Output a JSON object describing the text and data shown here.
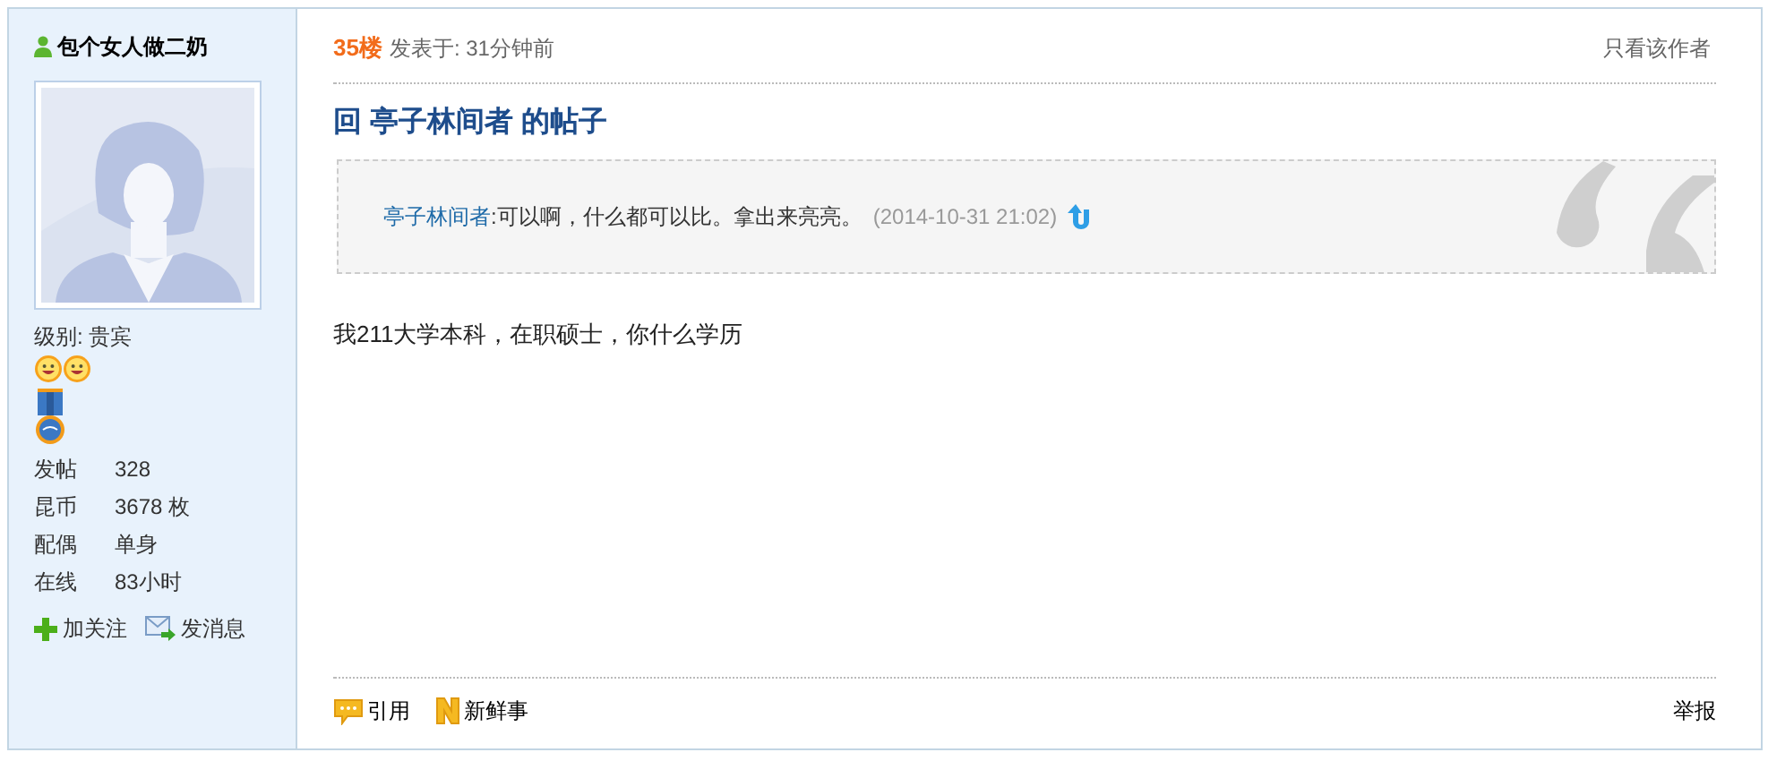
{
  "author": {
    "name": "包个女人做二奶",
    "level_label": "级别:",
    "level_value": "贵宾",
    "stats": [
      {
        "label": "发帖",
        "value": "328"
      },
      {
        "label": "昆币",
        "value": "3678 枚"
      },
      {
        "label": "配偶",
        "value": "单身"
      },
      {
        "label": "在线",
        "value": "83小时"
      }
    ],
    "actions": [
      {
        "kind": "follow",
        "label": "加关注"
      },
      {
        "kind": "message",
        "label": "发消息"
      }
    ]
  },
  "post": {
    "floor": "35楼",
    "posted": "发表于: 31分钟前",
    "author_only": "只看该作者",
    "title": "回 亭子林间者 的帖子",
    "quote": {
      "user": "亭子林间者",
      "text": ":可以啊，什么都可以比。拿出来亮亮。",
      "time": "(2014-10-31 21:02)"
    },
    "body": "我211大学本科，在职硕士，你什么学历",
    "footer_actions": [
      {
        "kind": "quote",
        "label": "引用"
      },
      {
        "kind": "news",
        "label": "新鲜事"
      }
    ],
    "report": "举报"
  }
}
